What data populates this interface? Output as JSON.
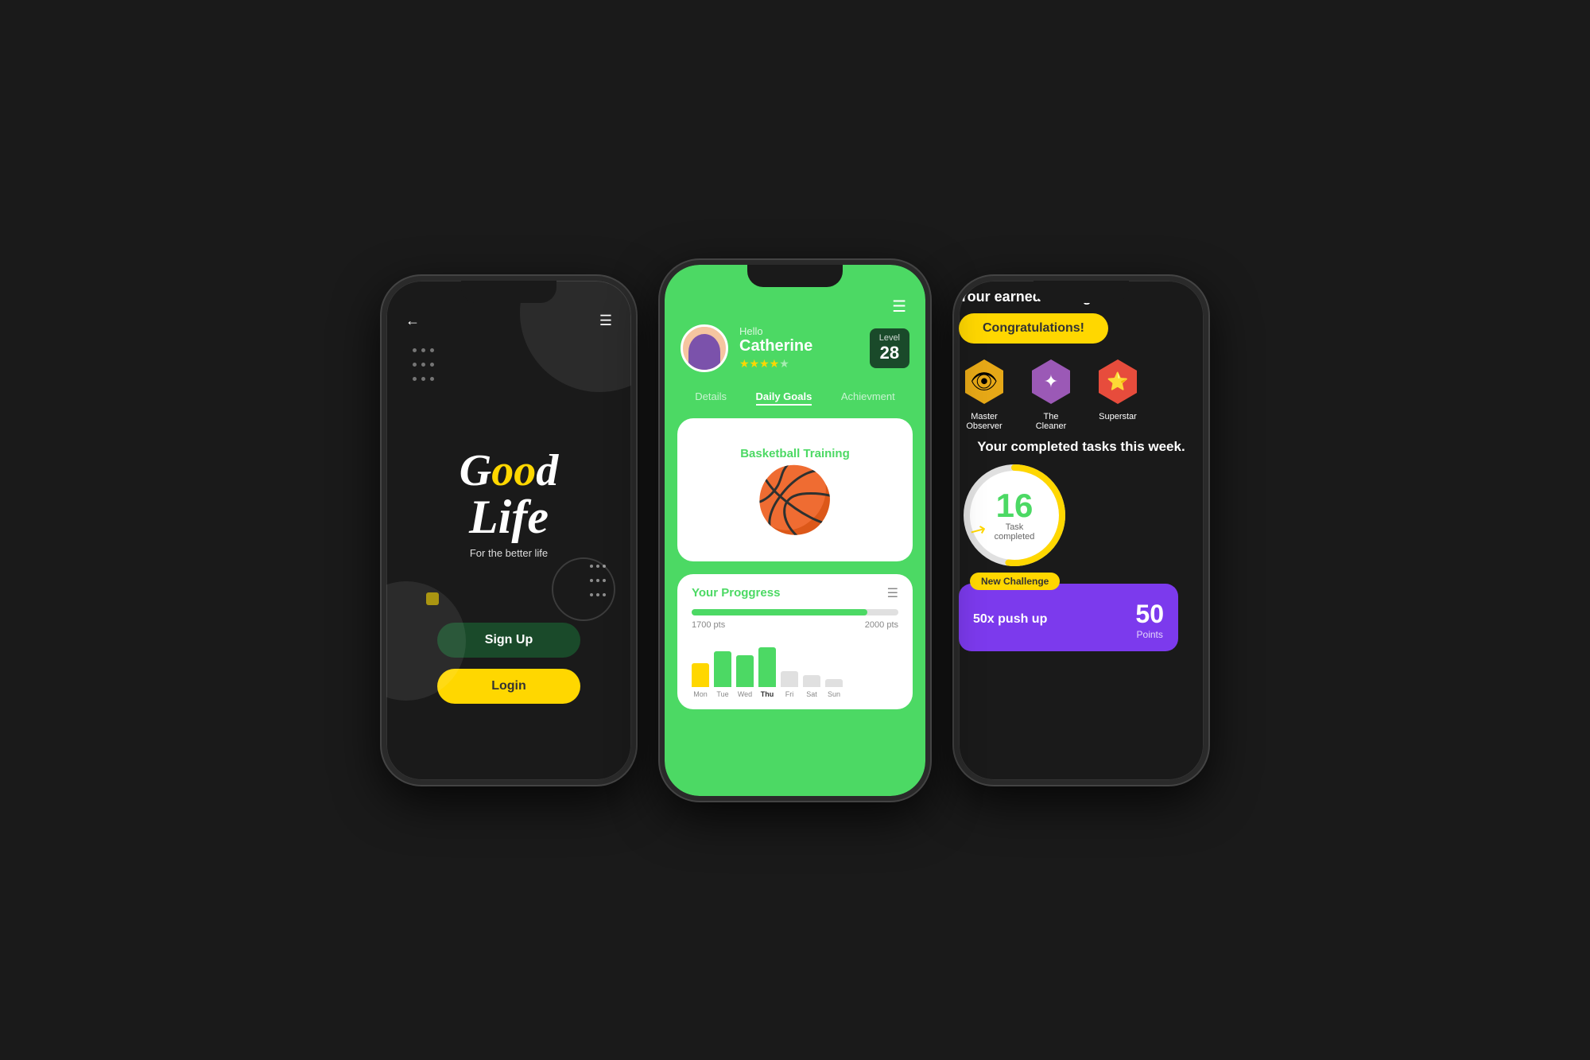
{
  "phone1": {
    "back_icon": "←",
    "menu_icon": "☰",
    "logo_good": "Good",
    "logo_life": "Life",
    "tagline": "For the better life",
    "signup_label": "Sign Up",
    "login_label": "Login"
  },
  "phone2": {
    "menu_icon": "☰",
    "user_hello": "Hello",
    "user_name": "Catherine",
    "level_label": "Level",
    "level_number": "28",
    "tab_details": "Details",
    "tab_daily_goals": "Daily Goals",
    "tab_achievement": "Achievment",
    "card_basketball_title": "Basketball Training",
    "basketball_emoji": "🏀",
    "progress_title": "Your Proggress",
    "progress_start_pts": "1700 pts",
    "progress_end_pts": "2000 pts",
    "chart_days": [
      "Mon",
      "Tue",
      "Wed",
      "Thu",
      "Fri",
      "Sat",
      "Sun"
    ],
    "chart_active_day": "Thu"
  },
  "phone3": {
    "badge_earned_title": "Your earned a badge",
    "congrats_label": "Congratulations!",
    "badges": [
      {
        "name": "Master Observer",
        "icon": "👁",
        "color": "#e6a817"
      },
      {
        "name": "The Cleaner",
        "icon": "✦",
        "color": "#9b59b6"
      },
      {
        "name": "Superstar",
        "icon": "⭐",
        "color": "#e74c3c"
      }
    ],
    "completed_title": "Your completed tasks this week.",
    "tasks_number": "16",
    "tasks_label": "Task completed",
    "challenge_badge": "New Challenge",
    "challenge_name": "50x push up",
    "challenge_points": "50",
    "challenge_pts_label": "Points"
  }
}
